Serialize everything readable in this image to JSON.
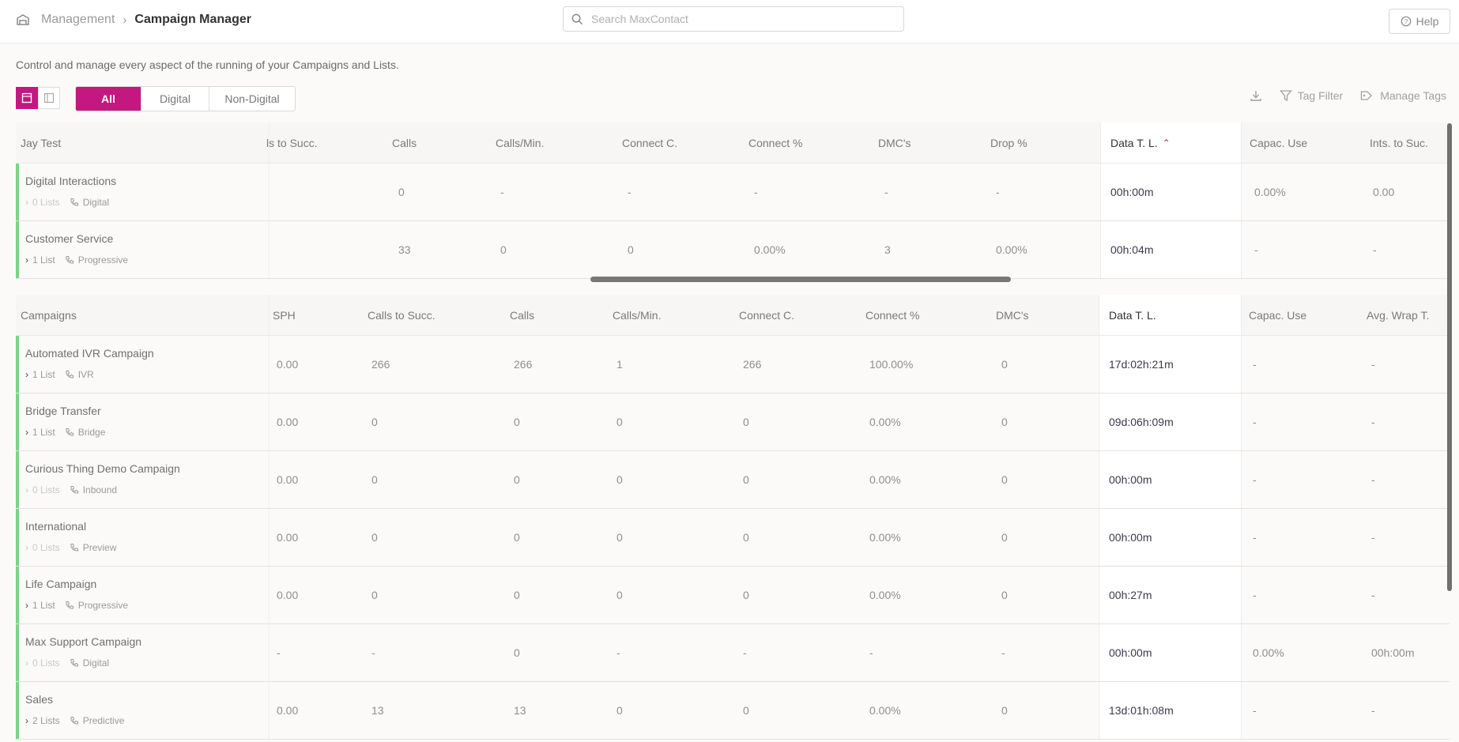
{
  "breadcrumb": {
    "parent": "Management",
    "current": "Campaign Manager"
  },
  "search": {
    "placeholder": "Search MaxContact"
  },
  "help_label": "Help",
  "description": "Control and manage every aspect of the running of your Campaigns and Lists.",
  "filter_tabs": [
    "All",
    "Digital",
    "Non-Digital"
  ],
  "toolbar": {
    "tag_filter": "Tag Filter",
    "manage_tags": "Manage Tags"
  },
  "accent_color": "#c2187f",
  "status_color": "#7bd38a",
  "group1": {
    "title": "Jay Test",
    "columns": [
      "ls to Succ.",
      "Calls",
      "Calls/Min.",
      "Connect C.",
      "Connect %",
      "DMC's",
      "Drop %",
      "Data T. L.",
      "Capac. Use",
      "Ints. to Suc."
    ],
    "rows": [
      {
        "name": "Digital Interactions",
        "lists": "0 Lists",
        "type": "Digital",
        "values": [
          "",
          "0",
          "-",
          "-",
          "-",
          "-",
          "-",
          "00h:00m",
          "0.00%",
          "0.00"
        ]
      },
      {
        "name": "Customer Service",
        "lists": "1 List",
        "type": "Progressive",
        "values": [
          "",
          "33",
          "0",
          "0",
          "0.00%",
          "3",
          "0.00%",
          "00h:04m",
          "-",
          "-"
        ]
      }
    ]
  },
  "group2": {
    "title": "Campaigns",
    "columns": [
      "SPH",
      "Calls to Succ.",
      "Calls",
      "Calls/Min.",
      "Connect C.",
      "Connect %",
      "DMC's",
      "Data T. L.",
      "Capac. Use",
      "Avg. Wrap T."
    ],
    "rows": [
      {
        "name": "Automated IVR Campaign",
        "lists": "1 List",
        "type": "IVR",
        "values": [
          "0.00",
          "266",
          "266",
          "1",
          "266",
          "100.00%",
          "0",
          "17d:02h:21m",
          "-",
          "-"
        ]
      },
      {
        "name": "Bridge Transfer",
        "lists": "1 List",
        "type": "Bridge",
        "values": [
          "0.00",
          "0",
          "0",
          "0",
          "0",
          "0.00%",
          "0",
          "09d:06h:09m",
          "-",
          "-"
        ]
      },
      {
        "name": "Curious Thing Demo Campaign",
        "lists": "0 Lists",
        "type": "Inbound",
        "values": [
          "0.00",
          "0",
          "0",
          "0",
          "0",
          "0.00%",
          "0",
          "00h:00m",
          "-",
          "-"
        ]
      },
      {
        "name": "International",
        "lists": "0 Lists",
        "type": "Preview",
        "values": [
          "0.00",
          "0",
          "0",
          "0",
          "0",
          "0.00%",
          "0",
          "00h:00m",
          "-",
          "-"
        ]
      },
      {
        "name": "Life Campaign",
        "lists": "1 List",
        "type": "Progressive",
        "values": [
          "0.00",
          "0",
          "0",
          "0",
          "0",
          "0.00%",
          "0",
          "00h:27m",
          "-",
          "-"
        ]
      },
      {
        "name": "Max Support Campaign",
        "lists": "0 Lists",
        "type": "Digital",
        "values": [
          "-",
          "-",
          "0",
          "-",
          "-",
          "-",
          "-",
          "00h:00m",
          "0.00%",
          "00h:00m"
        ]
      },
      {
        "name": "Sales",
        "lists": "2 Lists",
        "type": "Predictive",
        "values": [
          "0.00",
          "13",
          "13",
          "0",
          "0",
          "0.00%",
          "0",
          "13d:01h:08m",
          "-",
          "-"
        ]
      }
    ]
  }
}
